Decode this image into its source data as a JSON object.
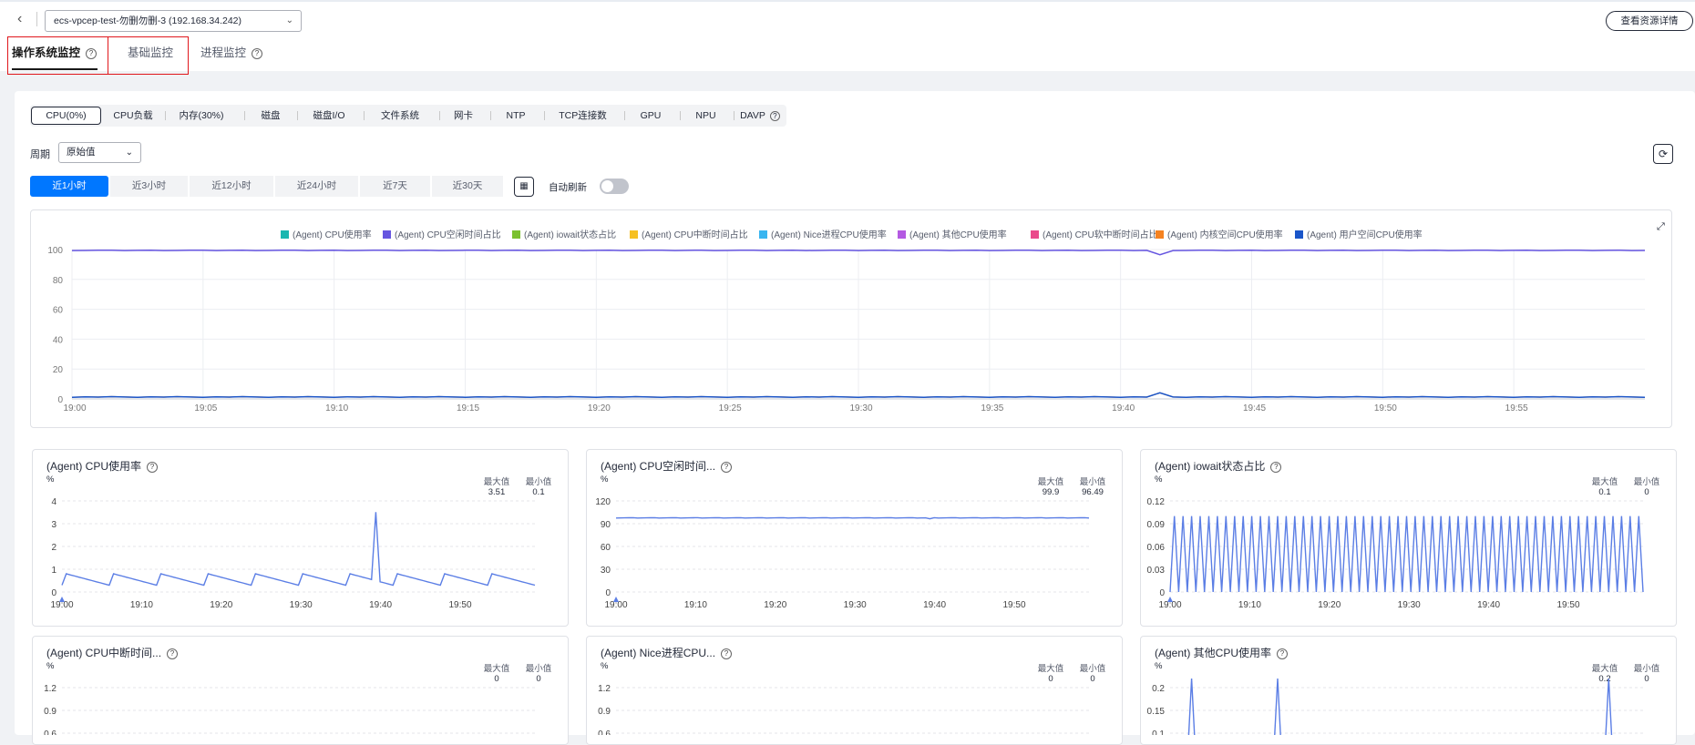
{
  "header": {
    "instance": "ecs-vpcep-test-勿删勿删-3 (192.168.34.242)",
    "detail_button": "查看资源详情"
  },
  "tabs": [
    {
      "label": "操作系统监控",
      "help": true
    },
    {
      "label": "基础监控",
      "help": false
    },
    {
      "label": "进程监控",
      "help": true
    }
  ],
  "metric_tabs": [
    "CPU(0%)",
    "CPU负载",
    "内存(30%)",
    "磁盘",
    "磁盘I/O",
    "文件系统",
    "网卡",
    "NTP",
    "TCP连接数",
    "GPU",
    "NPU",
    "DAVP"
  ],
  "period": {
    "label": "周期",
    "value": "原始值"
  },
  "time_ranges": [
    "近1小时",
    "近3小时",
    "近12小时",
    "近24小时",
    "近7天",
    "近30天"
  ],
  "auto_refresh_label": "自动刷新",
  "colors": {
    "accent": "#0077ff",
    "line": "#5b7ee5",
    "highlight": "#e0171c"
  },
  "main_chart": {
    "legend": [
      {
        "name": "(Agent) CPU使用率",
        "color": "#1ab7b0"
      },
      {
        "name": "(Agent) CPU空闲时间占比",
        "color": "#6656e0"
      },
      {
        "name": "(Agent) iowait状态占比",
        "color": "#7bc12f"
      },
      {
        "name": "(Agent) CPU中断时间占比",
        "color": "#f6c022"
      },
      {
        "name": "(Agent) Nice进程CPU使用率",
        "color": "#38b5f0"
      },
      {
        "name": "(Agent) 其他CPU使用率",
        "color": "#b45ae2"
      },
      {
        "name": "(Agent) CPU软中断时间占比",
        "color": "#ea4a8b"
      },
      {
        "name": "(Agent) 内核空间CPU使用率",
        "color": "#f58220"
      },
      {
        "name": "(Agent) 用户空间CPU使用率",
        "color": "#1a55c9"
      }
    ],
    "yticks": [
      "100",
      "80",
      "60",
      "40",
      "20",
      "0"
    ],
    "xticks": [
      "19:00",
      "19:05",
      "19:10",
      "19:15",
      "19:20",
      "19:25",
      "19:30",
      "19:35",
      "19:40",
      "19:45",
      "19:50",
      "19:55"
    ]
  },
  "small_charts": [
    {
      "title": "(Agent) CPU使用率",
      "unit": "%",
      "max_label": "最大值",
      "min_label": "最小值",
      "max": "3.51",
      "min": "0.1",
      "yticks": [
        "4",
        "3",
        "2",
        "1",
        "0"
      ],
      "xticks": [
        "19:00",
        "19:10",
        "19:20",
        "19:30",
        "19:40",
        "19:50"
      ]
    },
    {
      "title": "(Agent) CPU空闲时间...",
      "unit": "%",
      "max_label": "最大值",
      "min_label": "最小值",
      "max": "99.9",
      "min": "96.49",
      "yticks": [
        "120",
        "90",
        "60",
        "30",
        "0"
      ],
      "xticks": [
        "19:00",
        "19:10",
        "19:20",
        "19:30",
        "19:40",
        "19:50"
      ]
    },
    {
      "title": "(Agent) iowait状态占比",
      "unit": "%",
      "max_label": "最大值",
      "min_label": "最小值",
      "max": "0.1",
      "min": "0",
      "yticks": [
        "0.12",
        "0.09",
        "0.06",
        "0.03",
        "0"
      ],
      "xticks": [
        "19:00",
        "19:10",
        "19:20",
        "19:30",
        "19:40",
        "19:50"
      ]
    },
    {
      "title": "(Agent) CPU中断时间...",
      "unit": "%",
      "max_label": "最大值",
      "min_label": "最小值",
      "max": "0",
      "min": "0",
      "yticks": [
        "1.2",
        "0.9",
        "0.6"
      ],
      "xticks": []
    },
    {
      "title": "(Agent) Nice进程CPU...",
      "unit": "%",
      "max_label": "最大值",
      "min_label": "最小值",
      "max": "0",
      "min": "0",
      "yticks": [
        "1.2",
        "0.9",
        "0.6"
      ],
      "xticks": []
    },
    {
      "title": "(Agent) 其他CPU使用率",
      "unit": "%",
      "max_label": "最大值",
      "min_label": "最小值",
      "max": "0.2",
      "min": "0",
      "yticks": [
        "0.2",
        "0.15",
        "0.1"
      ],
      "xticks": []
    }
  ]
}
